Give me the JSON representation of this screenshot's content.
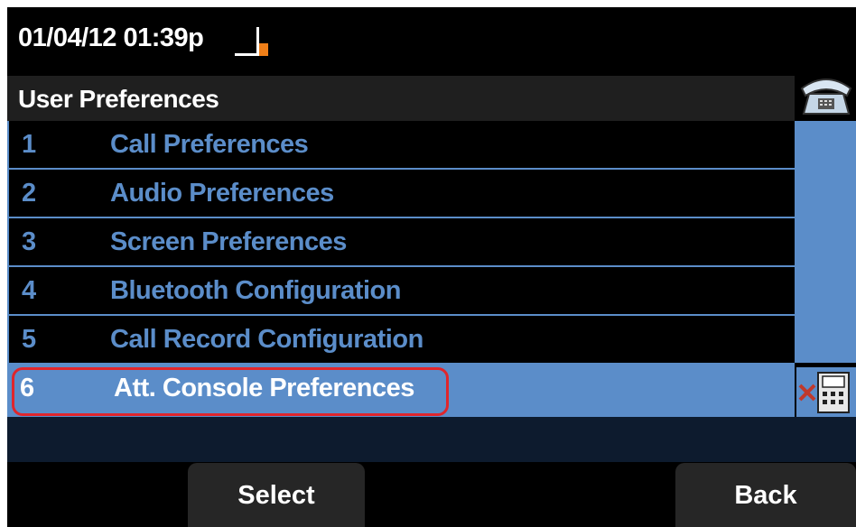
{
  "status": {
    "datetime": "01/04/12 01:39p",
    "signal_icon": "signal-strength-icon"
  },
  "header": {
    "title": "User Preferences"
  },
  "menu": {
    "items": [
      {
        "number": "1",
        "label": "Call Preferences"
      },
      {
        "number": "2",
        "label": "Audio Preferences"
      },
      {
        "number": "3",
        "label": "Screen Preferences"
      },
      {
        "number": "4",
        "label": "Bluetooth Configuration"
      },
      {
        "number": "5",
        "label": "Call Record Configuration"
      },
      {
        "number": "6",
        "label": "Att. Console Preferences"
      }
    ],
    "selected_index": 5
  },
  "icons": {
    "phone": "phone-icon",
    "line_status": "line-not-registered-icon"
  },
  "softkeys": {
    "select": "Select",
    "back": "Back"
  },
  "colors": {
    "accent": "#5b8dc9",
    "highlight": "#e0262c",
    "signal": "#f07f18"
  }
}
